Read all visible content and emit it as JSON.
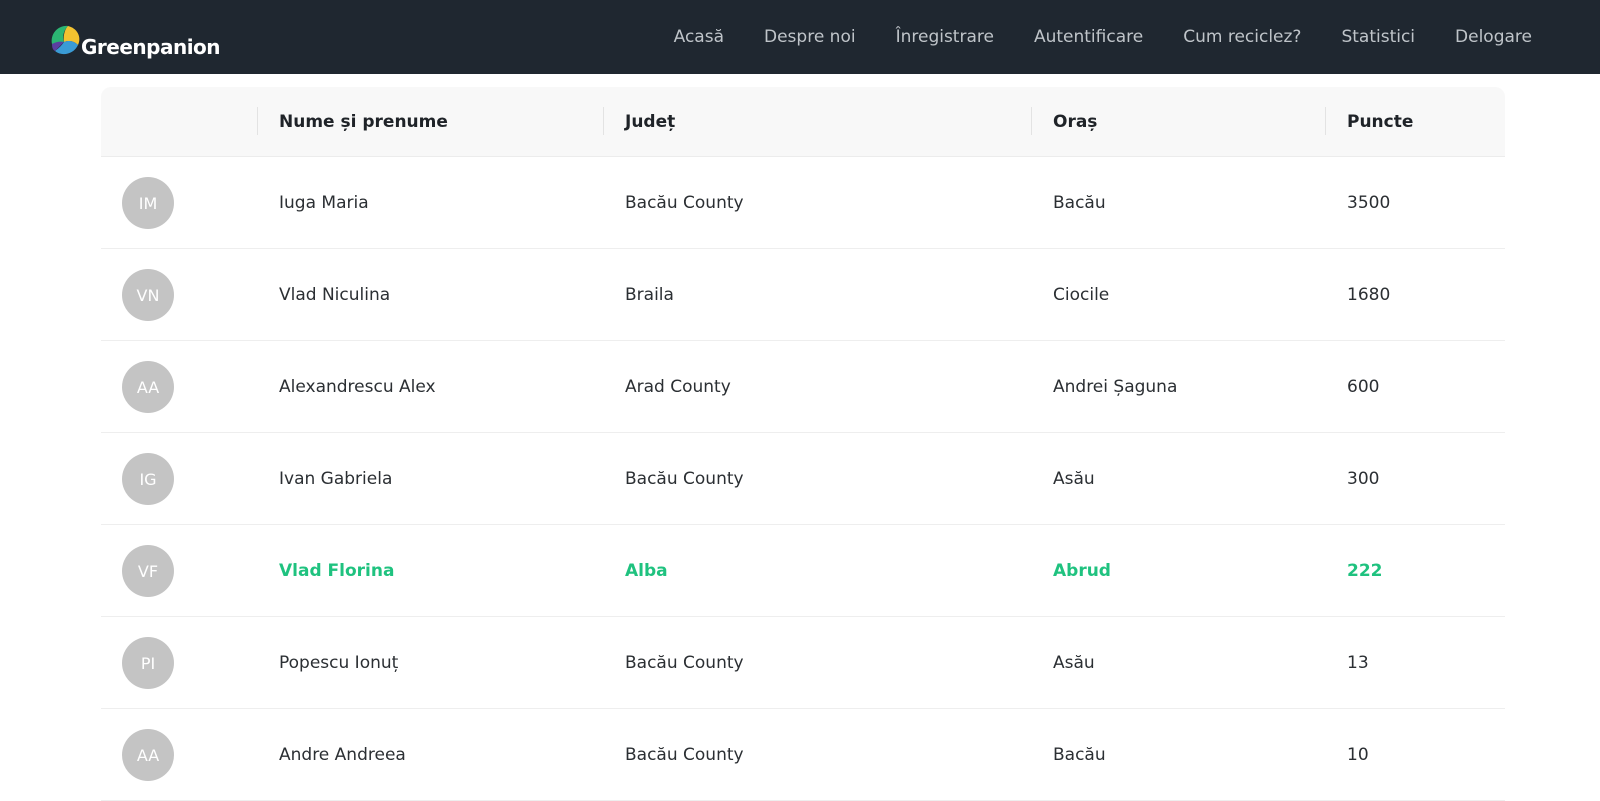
{
  "brand": {
    "name": "Greenpanion"
  },
  "nav": {
    "items": [
      "Acasă",
      "Despre noi",
      "Înregistrare",
      "Autentificare",
      "Cum reciclez?",
      "Statistici",
      "Delogare"
    ]
  },
  "table": {
    "headers": {
      "name": "Nume și prenume",
      "county": "Județ",
      "city": "Oraș",
      "points": "Puncte"
    },
    "rows": [
      {
        "initials": "IM",
        "name": "Iuga Maria",
        "county": "Bacău County",
        "city": "Bacău",
        "points": "3500",
        "highlight": false
      },
      {
        "initials": "VN",
        "name": "Vlad Niculina",
        "county": "Braila",
        "city": "Ciocile",
        "points": "1680",
        "highlight": false
      },
      {
        "initials": "AA",
        "name": "Alexandrescu Alex",
        "county": "Arad County",
        "city": "Andrei Șaguna",
        "points": "600",
        "highlight": false
      },
      {
        "initials": "IG",
        "name": "Ivan Gabriela",
        "county": "Bacău County",
        "city": "Asău",
        "points": "300",
        "highlight": false
      },
      {
        "initials": "VF",
        "name": "Vlad Florina",
        "county": "Alba",
        "city": "Abrud",
        "points": "222",
        "highlight": true
      },
      {
        "initials": "PI",
        "name": "Popescu Ionuț",
        "county": "Bacău County",
        "city": "Asău",
        "points": "13",
        "highlight": false
      },
      {
        "initials": "AA",
        "name": "Andre Andreea",
        "county": "Bacău County",
        "city": "Bacău",
        "points": "10",
        "highlight": false
      }
    ]
  },
  "colors": {
    "navbar": "#1f2730",
    "highlight": "#1fc27f",
    "avatar": "#c4c4c4"
  }
}
